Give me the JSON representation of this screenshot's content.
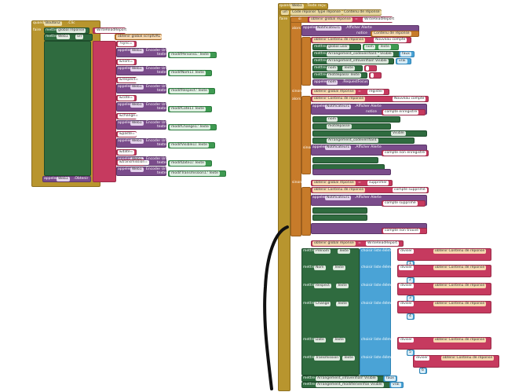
{
  "left_panel": {
    "event_header": {
      "when": "quand",
      "component": "Bouton2",
      "event": ".Clic"
    },
    "do": "faire",
    "set_global": {
      "label": "mettre",
      "var": "global réponse",
      "to": "à",
      "value": "WriteReadReport"
    },
    "set_url": {
      "label": "mettre",
      "component": "Web1",
      "prop": "Url",
      "to": "à",
      "join": "joint",
      "value": "obtenir global scriptURL"
    },
    "rows": [
      {
        "text": "?sync=",
        "encode": "Encoder Url",
        "label": "appeler",
        "component": "Web1",
        "param": "texte",
        "field": "modifPersons11",
        "prop": "Texte"
      },
      {
        "text": "&nom=",
        "encode": "Encoder Url",
        "label": "appeler",
        "component": "Web1",
        "param": "texte",
        "field": "modifNom11",
        "prop": "Texte"
      },
      {
        "text": "&respect=",
        "encode": "Encoder Url",
        "label": "appeler",
        "component": "Web1",
        "param": "texte",
        "field": "modifRespect11",
        "prop": "Texte"
      },
      {
        "text": "&cote=",
        "encode": "Encoder Url",
        "label": "appeler",
        "component": "Web1",
        "param": "texte",
        "field": "modifCote11",
        "prop": "Texte"
      },
      {
        "text": "&change=",
        "encode": "Encoder Url",
        "label": "appeler",
        "component": "Web1",
        "param": "texte",
        "field": "modifChange11",
        "prop": "Texte"
      },
      {
        "text": "&paste=",
        "encode": "Encoder Url",
        "label": "appeler",
        "component": "Web1",
        "param": "texte",
        "field": "modifVisible11",
        "prop": "Texte"
      },
      {
        "text": "&date=",
        "encode": "Encoder Url",
        "label": "appeler",
        "component": "Web1",
        "param": "texte",
        "field": "modifDate11",
        "prop": "Texte"
      },
      {
        "text": "&transmission=",
        "encode": "Encoder Url",
        "label": "appeler",
        "component": "Web1",
        "param": "texte",
        "field": "modifTransmission11",
        "prop": "Texte"
      }
    ],
    "footer": {
      "label": "appeler",
      "component": "Web1",
      "method": ".Obtenir"
    }
  },
  "right_panel": {
    "event_header": {
      "when": "quand",
      "component": "Web1",
      "event": ".Texte reçu"
    },
    "params": [
      "url",
      "Code réponse",
      "Type réponse",
      "Contenu de réponse"
    ],
    "do": "faire",
    "if_label": "si",
    "then_label": "alors",
    "else_if_label": "sinon si",
    "call_label": "appeler",
    "set_label": "mettre",
    "notifier": "Notificateur1",
    "alert": ".Afficher Alerte",
    "notice": "notice",
    "get_response": "obtenir Contenu de réponse",
    "conditions": [
      {
        "var": "obtenir global réponse",
        "op": "=",
        "value": "WriteReadReport"
      },
      {
        "var": "obtenir global réponse",
        "op": "=",
        "value": "register"
      },
      {
        "var": "obtenir global réponse",
        "op": "=",
        "value": "supprimer"
      },
      {
        "var": "obtenir global réponse",
        "op": "=",
        "value": "WriteReadReport"
      }
    ],
    "messages": [
      "Contenu de réponse",
      "Nouveau compte",
      "compte enregistré",
      "compte non enregistré",
      "compte supprimé",
      "compte supprimé",
      "compte non trouvé"
    ],
    "set_rows": [
      {
        "component": "global user",
        "prop": "",
        "value": "nom",
        "extra": "Texte"
      },
      {
        "component": "Arrangement_codeverifiant",
        "prop": "Visible",
        "value": "faux"
      },
      {
        "component": "Arrangement_infoverifiant",
        "prop": "Visible",
        "value": "vrai"
      },
      {
        "component": "nom",
        "prop": "Texte",
        "value": " "
      },
      {
        "component": "motdepasse",
        "prop": "Texte",
        "value": " "
      },
      {
        "component": "nom",
        "prop": ".RequestFocus",
        "value": ""
      }
    ],
    "list_rows": [
      {
        "component": "Prénom",
        "prop": "Texte",
        "select": "choisir liste élément",
        "list": "liste",
        "divider": "diviser",
        "index": "index",
        "idx": "1"
      },
      {
        "component": "Nom",
        "prop": "Texte",
        "select": "choisir liste élément",
        "list": "liste",
        "divider": "diviser",
        "index": "index",
        "idx": "2"
      },
      {
        "component": "Respect",
        "prop": "Texte",
        "select": "choisir liste élément",
        "list": "liste",
        "divider": "diviser",
        "index": "index",
        "idx": "3"
      },
      {
        "component": "Change",
        "prop": "Texte",
        "select": "choisir liste élément",
        "list": "liste",
        "divider": "diviser",
        "index": "index",
        "idx": "4"
      },
      {
        "component": "Date",
        "prop": "Texte",
        "select": "choisir liste élément",
        "list": "liste",
        "divider": "diviser",
        "index": "index",
        "idx": "5"
      },
      {
        "component": "Transmission",
        "prop": "Texte",
        "select": "choisir liste élément",
        "list": "liste",
        "divider": "diviser",
        "index": "index",
        "idx": "6"
      }
    ],
    "final_rows": [
      {
        "component": "Arrangement_infoverifiant",
        "prop": "Visible",
        "value": "faux"
      },
      {
        "component": "Arrangement_modifierverifiant",
        "prop": "Visible",
        "value": "vrai"
      }
    ]
  },
  "colors": {
    "event": "#b8952e",
    "set": "#2f6b3f",
    "call": "#7a4c8b",
    "text": "#c63a5f",
    "control": "#c77b2a",
    "list": "#4aa3d6",
    "annotation": "#111111"
  }
}
